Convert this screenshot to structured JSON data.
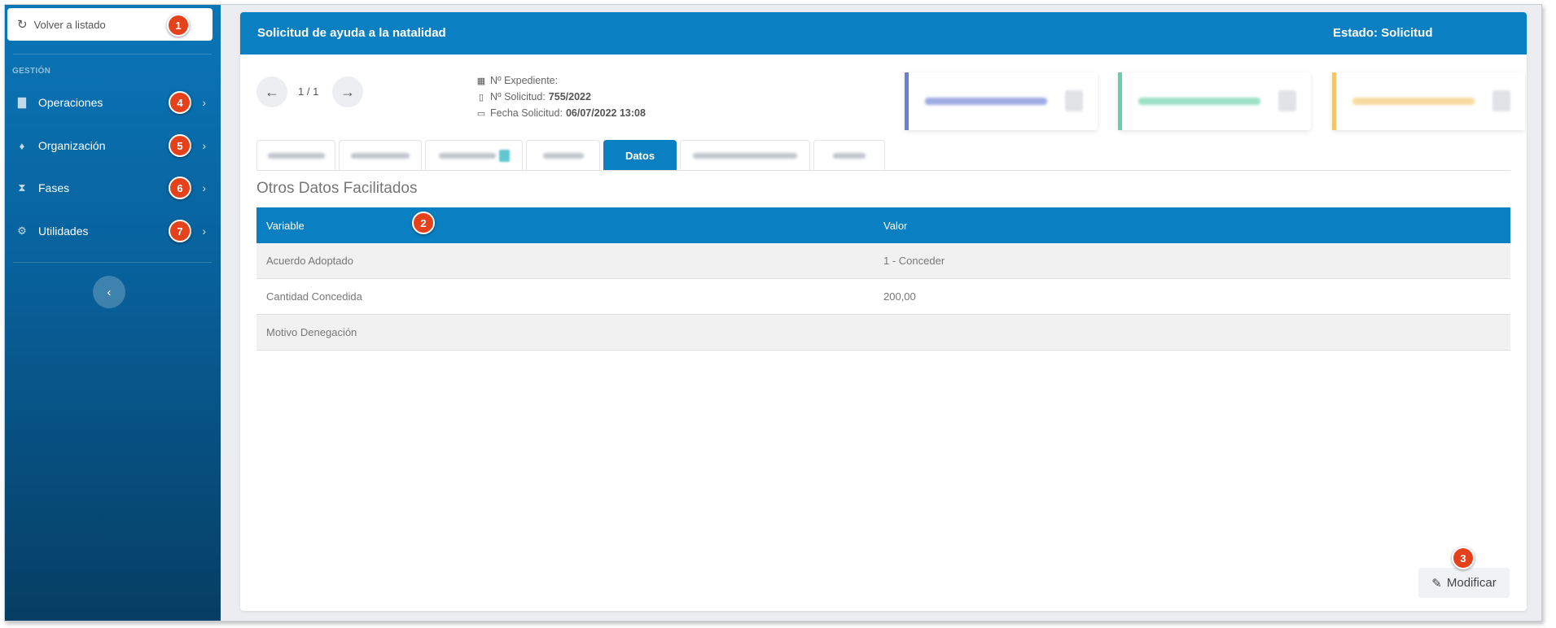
{
  "sidebar": {
    "back_label": "Volver a listado",
    "back_icon": "refresh-icon",
    "section_label": "GESTIÓN",
    "items": [
      {
        "label": "Operaciones",
        "icon": "file-icon",
        "badge": "4"
      },
      {
        "label": "Organización",
        "icon": "pin-icon",
        "badge": "5"
      },
      {
        "label": "Fases",
        "icon": "hourglass-icon",
        "badge": "6"
      },
      {
        "label": "Utilidades",
        "icon": "cogs-icon",
        "badge": "7"
      }
    ],
    "collapse_icon": "chevron-left-icon"
  },
  "badges": {
    "back": "1",
    "table": "2",
    "modify": "3"
  },
  "header": {
    "title": "Solicitud de ayuda a la natalidad",
    "status": "Estado: Solicitud"
  },
  "pager": {
    "text": "1 / 1"
  },
  "meta": {
    "expediente_label": "Nº Expediente:",
    "solicitud_label": "Nº Solicitud:",
    "solicitud_value": "755/2022",
    "fecha_label": "Fecha Solicitud:",
    "fecha_value": "06/07/2022 13:08"
  },
  "cards": [
    {
      "accent": "#6b7fd6"
    },
    {
      "accent": "#66d1a6"
    },
    {
      "accent": "#f2c66b"
    }
  ],
  "tabs": {
    "active_label": "Datos"
  },
  "section_title": "Otros Datos Facilitados",
  "table": {
    "headers": [
      "Variable",
      "Valor"
    ],
    "rows": [
      [
        "Acuerdo Adoptado",
        "1 - Conceder"
      ],
      [
        "Cantidad Concedida",
        "200,00"
      ],
      [
        "Motivo Denegación",
        ""
      ]
    ]
  },
  "modify_label": "Modificar",
  "colors": {
    "primary": "#0a7fc1",
    "badge": "#e5411b"
  }
}
